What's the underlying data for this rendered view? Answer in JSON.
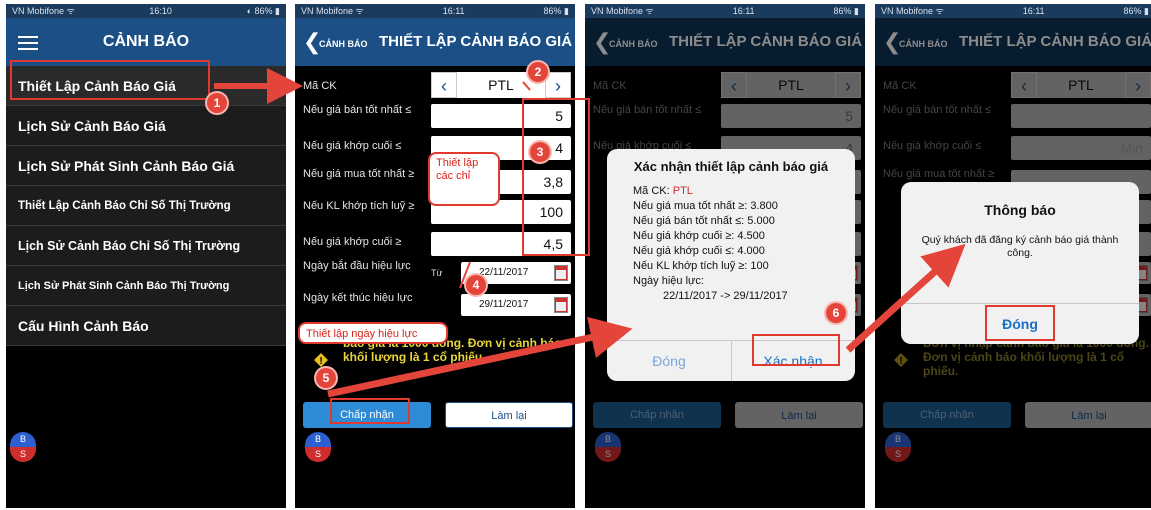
{
  "status": {
    "carrier": "VN Mobifone",
    "battery": "86%",
    "time1": "16:10",
    "time2": "16:11",
    "time3": "16:11",
    "time4": "16:11"
  },
  "screen1": {
    "title": "CẢNH BÁO",
    "menu": [
      "Thiết Lập Cảnh Báo Giá",
      "Lịch Sử Cảnh Báo Giá",
      "Lịch Sử Phát Sinh Cảnh Báo Giá",
      "Thiết Lập Cảnh Báo Chỉ Số Thị Trường",
      "Lịch Sử Cảnh Báo Chỉ Số  Thị Trường",
      "Lịch Sử Phát Sinh Cảnh Báo Thị Trường",
      "Cấu Hình Cảnh Báo"
    ]
  },
  "form": {
    "back_label": "CẢNH BÁO",
    "title": "THIẾT LẬP CẢNH BÁO GIÁ",
    "stock_label": "Mã CK",
    "stock_code": "PTL",
    "labels": [
      "Nếu giá bán tốt nhất ≤",
      "Nếu giá khớp cuối ≤",
      "Nếu giá mua tốt nhất ≥",
      "Nếu KL khớp tích luỹ ≥",
      "Nếu giá khớp cuối ≥"
    ],
    "values": [
      "5",
      "4",
      "3,8",
      "100",
      "4,5"
    ],
    "start_label": "Ngày bắt đầu hiệu lực",
    "end_label": "Ngày kết thúc hiệu lực",
    "from_label": "Từ",
    "start_date": "22/11/2017",
    "end_date": "29/11/2017",
    "note": "Đơn vị nhập cảnh báo giá là 1000 đồng. Đơn vị cảnh báo khối lượng là 1 cổ phiếu.",
    "note_p2": "báo giá là 1000 đồng. Đơn vị cảnh báo khối lượng là 1 cổ phiếu.",
    "accept": "Chấp nhận",
    "reset": "Làm lại",
    "bs_top": "B",
    "bs_bottom": "S",
    "min_placeholder": "Min"
  },
  "confirm_dialog": {
    "title": "Xác nhận thiết lập cảnh báo giá",
    "stock_prefix": "Mã CK: ",
    "stock_code": "PTL",
    "lines": [
      "Nếu giá mua tốt nhất ≥: 3.800",
      "Nếu giá bán tốt nhất ≤: 5.000",
      "Nếu giá khớp cuối ≥: 4.500",
      "Nếu giá khớp cuối ≤: 4.000",
      "Nếu KL khớp tích luỹ ≥: 100",
      "Ngày hiệu lực:"
    ],
    "date_range": "22/11/2017 -> 29/11/2017",
    "close": "Đóng",
    "confirm": "Xác nhận"
  },
  "info_dialog": {
    "title": "Thông báo",
    "message": "Quý khách đã đăng ký cảnh báo giá thành công.",
    "close": "Đóng"
  },
  "annotations": {
    "callout_inputs": "Thiết lập các chỉ",
    "callout_dates": "Thiết lập ngày hiệu lực",
    "steps": [
      "1",
      "2",
      "3",
      "4",
      "5",
      "6"
    ]
  },
  "colors": {
    "navbar": "#1b4f86",
    "accent_red": "#e03a30",
    "note_yellow": "#e8d63a",
    "button_blue": "#2e8bd6"
  }
}
